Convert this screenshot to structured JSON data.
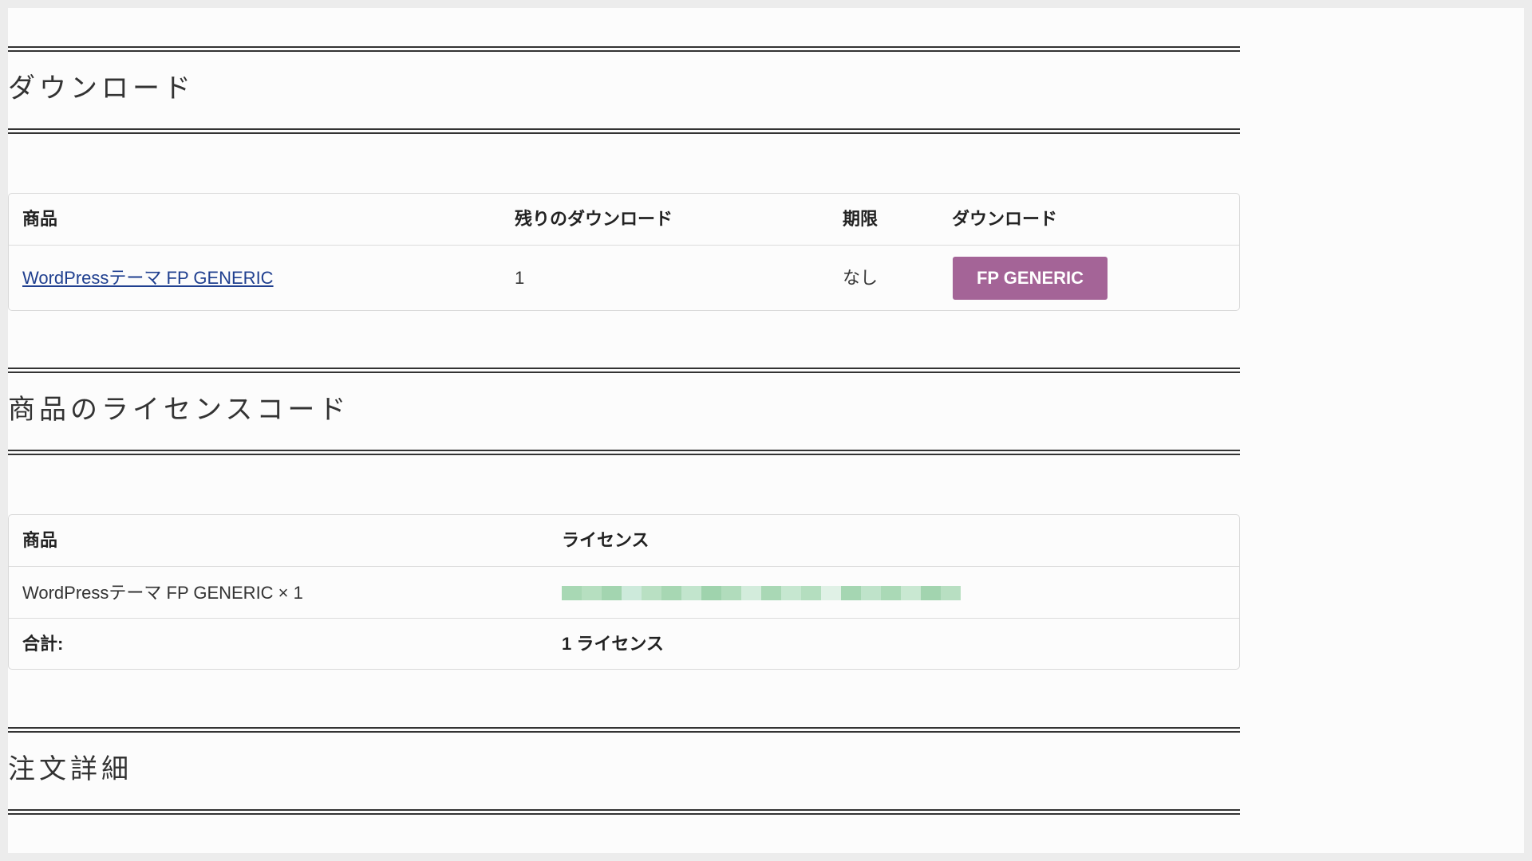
{
  "downloads_section": {
    "title": "ダウンロード",
    "columns": [
      "商品",
      "残りのダウンロード",
      "期限",
      "ダウンロード"
    ],
    "rows": [
      {
        "product": "WordPressテーマ FP GENERIC",
        "remaining": "1",
        "expires": "なし",
        "download_button": "FP GENERIC"
      }
    ]
  },
  "license_section": {
    "title": "商品のライセンスコード",
    "columns": [
      "商品",
      "ライセンス"
    ],
    "rows": [
      {
        "product": "WordPressテーマ FP GENERIC × 1"
      }
    ],
    "total_label": "合計:",
    "total_value": "1 ライセンス"
  },
  "order_details_section": {
    "title": "注文詳細"
  },
  "colors": {
    "button": "#a46497",
    "link": "#1f3f8f",
    "license_blur": "#a8d8b4"
  }
}
